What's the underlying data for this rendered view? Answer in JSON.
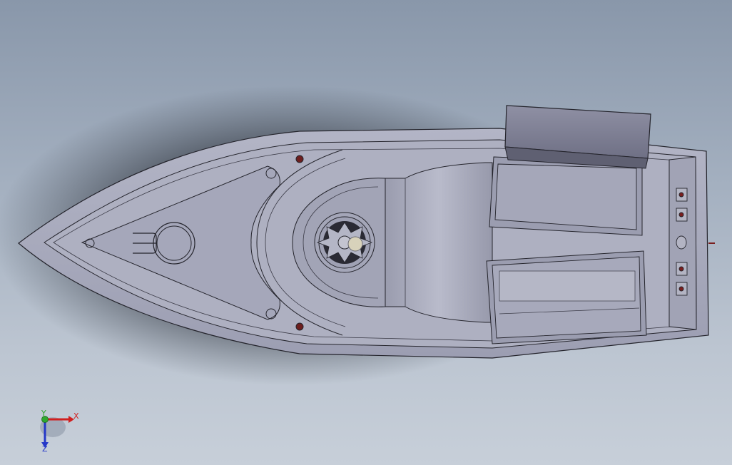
{
  "viewport": {
    "background_top": "#8997aa",
    "background_bottom": "#c7cfd9"
  },
  "model": {
    "name": "boat-hull",
    "hull_color": "#a7a9bc",
    "edge_color": "#24242c",
    "accent_color": "#7a1e1e"
  },
  "triad": {
    "x_label": "X",
    "y_label": "Y",
    "z_label": "Z",
    "x_color": "#d01f1f",
    "y_color": "#2fa82f",
    "z_color": "#2437c8"
  }
}
